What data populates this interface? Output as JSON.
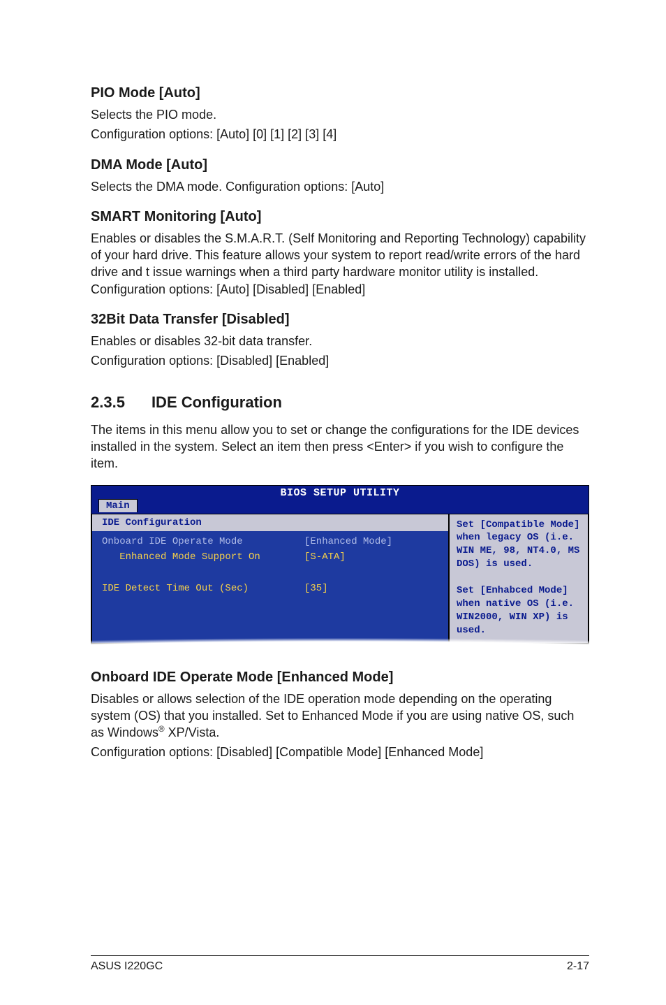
{
  "sections": {
    "pio": {
      "heading": "PIO Mode [Auto]",
      "line1": "Selects the PIO mode.",
      "line2": "Configuration options: [Auto] [0] [1] [2] [3] [4]"
    },
    "dma": {
      "heading": "DMA Mode [Auto]",
      "line1": "Selects the DMA mode. Configuration options: [Auto]"
    },
    "smart": {
      "heading": "SMART Monitoring [Auto]",
      "line1": "Enables or disables the S.M.A.R.T. (Self Monitoring and Reporting Technology) capability of your hard drive. This feature allows your system to report read/write errors of the hard drive and t issue warnings when a third party hardware monitor utility is installed. Configuration options: [Auto] [Disabled] [Enabled]"
    },
    "bit32": {
      "heading": "32Bit Data Transfer [Disabled]",
      "line1": "Enables or disables 32-bit data transfer.",
      "line2": "Configuration options: [Disabled] [Enabled]"
    },
    "idecfg": {
      "num": "2.3.5",
      "title": "IDE Configuration",
      "body": "The items in this menu allow you to set or change the configurations for the IDE devices installed in the system. Select an item then press <Enter> if you wish to configure the item."
    },
    "onboard": {
      "heading": "Onboard IDE Operate Mode [Enhanced Mode]",
      "line1a": "Disables or allows selection of the IDE operation mode depending on the operating system (OS) that you installed. Set to Enhanced Mode if you are using native OS, such as Windows",
      "line1b": " XP/Vista.",
      "line2": "Configuration options: [Disabled] [Compatible Mode] [Enhanced Mode]"
    }
  },
  "bios": {
    "titlebar": "BIOS SETUP UTILITY",
    "tab": "Main",
    "panel_title": "IDE Configuration",
    "rows": [
      {
        "label": "Onboard IDE Operate Mode",
        "value": "[Enhanced Mode]",
        "style": "dim"
      },
      {
        "label": "   Enhanced Mode Support On",
        "value": "[S-ATA]",
        "style": "yellow"
      },
      {
        "label": "",
        "value": "",
        "style": "blank"
      },
      {
        "label": "IDE Detect Time Out (Sec)",
        "value": "[35]",
        "style": "yellow"
      }
    ],
    "help": "Set [Compatible Mode] when legacy OS (i.e. WIN ME, 98, NT4.0, MS DOS) is used.\n\nSet [Enhabced Mode] when native OS (i.e. WIN2000, WIN XP) is used."
  },
  "footer": {
    "left": "ASUS I220GC",
    "right": "2-17"
  },
  "glyphs": {
    "reg": "®"
  }
}
